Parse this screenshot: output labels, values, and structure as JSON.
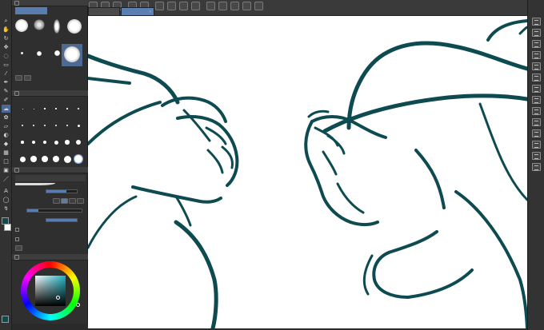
{
  "tabs": [
    {
      "label": "",
      "active": false
    },
    {
      "label": "",
      "active": true
    }
  ],
  "tool_palette": {
    "tools": [
      "magnifier-icon",
      "hand-icon",
      "rotate-icon",
      "move-icon",
      "lasso-icon",
      "selection-icon",
      "wand-icon",
      "eyedropper-icon",
      "pen-icon",
      "pencil-icon",
      "brush-icon",
      "airbrush-icon",
      "decoration-icon",
      "eraser-icon",
      "blend-icon",
      "fill-icon",
      "gradient-icon",
      "figure-icon",
      "frame-icon",
      "ruler-icon",
      "text-icon",
      "balloon-icon",
      "correction-icon"
    ],
    "main_color": "#0e4b50",
    "sub_color": "#ffffff"
  },
  "subtool_panel": {
    "title": "",
    "selected_group": "",
    "brushes": [
      {
        "label": "",
        "size": 16
      },
      {
        "label": "",
        "size": 14
      },
      {
        "label": "",
        "size": 12
      },
      {
        "label": "",
        "size": 16
      },
      {
        "label": "",
        "size": 5
      },
      {
        "label": "",
        "size": 6
      },
      {
        "label": "",
        "size": 18
      }
    ],
    "footer_labels": [
      ""
    ]
  },
  "brush_size_panel": {
    "title": "",
    "rows": [
      [
        "",
        "",
        "",
        "",
        "",
        ""
      ],
      [
        "",
        "",
        "",
        "",
        "",
        ""
      ],
      [
        "",
        "",
        "",
        "",
        "",
        ""
      ],
      [
        "",
        "",
        "",
        "",
        "",
        ""
      ]
    ]
  },
  "tool_property": {
    "title": "",
    "tool_name": "",
    "brush_size_label": "",
    "brush_size_value": "",
    "brush_size_fraction": 0.65,
    "antialias_label": "",
    "stabilization_label": "",
    "density_label": "",
    "density_value": "",
    "density_fraction": 1.0,
    "vector_label": "",
    "correction_label": "",
    "correction_value": ""
  },
  "color_panel": {
    "title": "",
    "selected_color": "#0e4b50",
    "hsv_readout": ""
  },
  "right_icons": [
    "layer-icon",
    "layer-property-icon",
    "navigator-icon",
    "history-icon",
    "material-icon",
    "sub-view-icon",
    "auto-action-icon",
    "item-bank-icon",
    "color-set-icon",
    "intermediate-color-icon",
    "similar-color-icon",
    "color-history-icon",
    "search-icon",
    "quick-access-icon"
  ],
  "canvas": {
    "background": "#ffffff",
    "line_color": "#0e4b50"
  }
}
